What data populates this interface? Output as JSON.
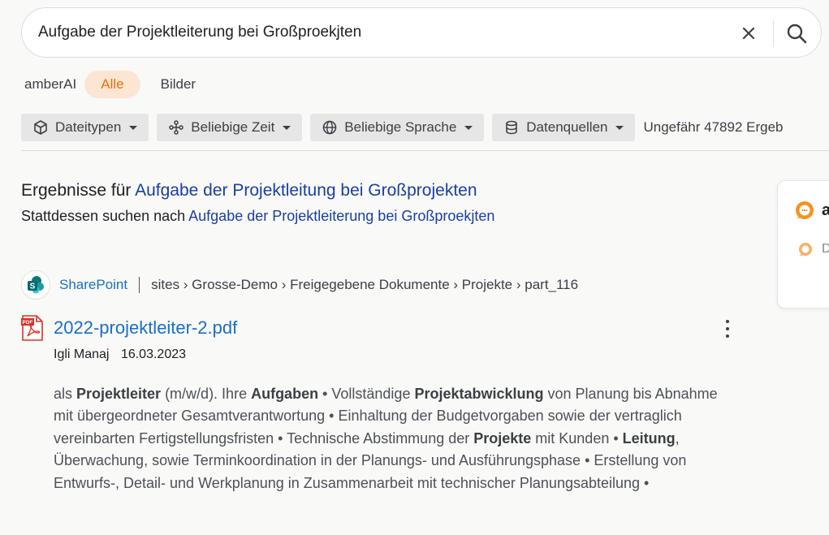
{
  "search": {
    "query": "Aufgabe der Projektleiterung bei Großproekjten"
  },
  "tabs": [
    {
      "label": "amberAI"
    },
    {
      "label": "Alle"
    },
    {
      "label": "Bilder"
    }
  ],
  "filters": [
    {
      "label": "Dateitypen",
      "icon": "cube-icon"
    },
    {
      "label": "Beliebige Zeit",
      "icon": "timeline-icon"
    },
    {
      "label": "Beliebige Sprache",
      "icon": "globe-icon"
    },
    {
      "label": "Datenquellen",
      "icon": "database-icon"
    }
  ],
  "results_count": "Ungefähr 47892 Ergeb",
  "correction": {
    "prefix": "Ergebnisse für",
    "corrected": "Aufgabe der Projektleitung bei Großprojekten",
    "instead_prefix": "Stattdessen suchen nach",
    "original": "Aufgabe der Projektleiterung bei Großproekjten"
  },
  "result": {
    "source": "SharePoint",
    "breadcrumb": "sites › Grosse-Demo › Freigegebene Dokumente › Projekte › part_116",
    "title": "2022-projektleiter-2.pdf",
    "author": "Igli Manaj",
    "date": "16.03.2023",
    "snippet": [
      {
        "t": "als ",
        "b": false
      },
      {
        "t": "Projektleiter",
        "b": true
      },
      {
        "t": " (m/w/d). Ihre ",
        "b": false
      },
      {
        "t": "Aufgaben",
        "b": true
      },
      {
        "t": " • Vollständige ",
        "b": false
      },
      {
        "t": "Projektabwicklung",
        "b": true
      },
      {
        "t": " von Planung bis Abnahme mit übergeordneter Gesamtverantwortung • Einhaltung der Budgetvorgaben sowie der vertraglich vereinbarten Fertigstellungsfristen • Technische Abstimmung der ",
        "b": false
      },
      {
        "t": "Projekte",
        "b": true
      },
      {
        "t": " mit Kunden • ",
        "b": false
      },
      {
        "t": "Leitung",
        "b": true
      },
      {
        "t": ", Überwachung, sowie Terminkoordination in der Planungs- und Ausführungsphase • Erstellung von Entwurfs-, Detail- und Werkplanung in Zusammenarbeit mit technischer Planungsabteilung •",
        "b": false
      }
    ]
  },
  "side_card": {
    "title": "a",
    "subtitle": "D"
  },
  "colors": {
    "accent": "#e8710a",
    "link": "#1a3fa3",
    "result_link": "#1a6fc4"
  }
}
